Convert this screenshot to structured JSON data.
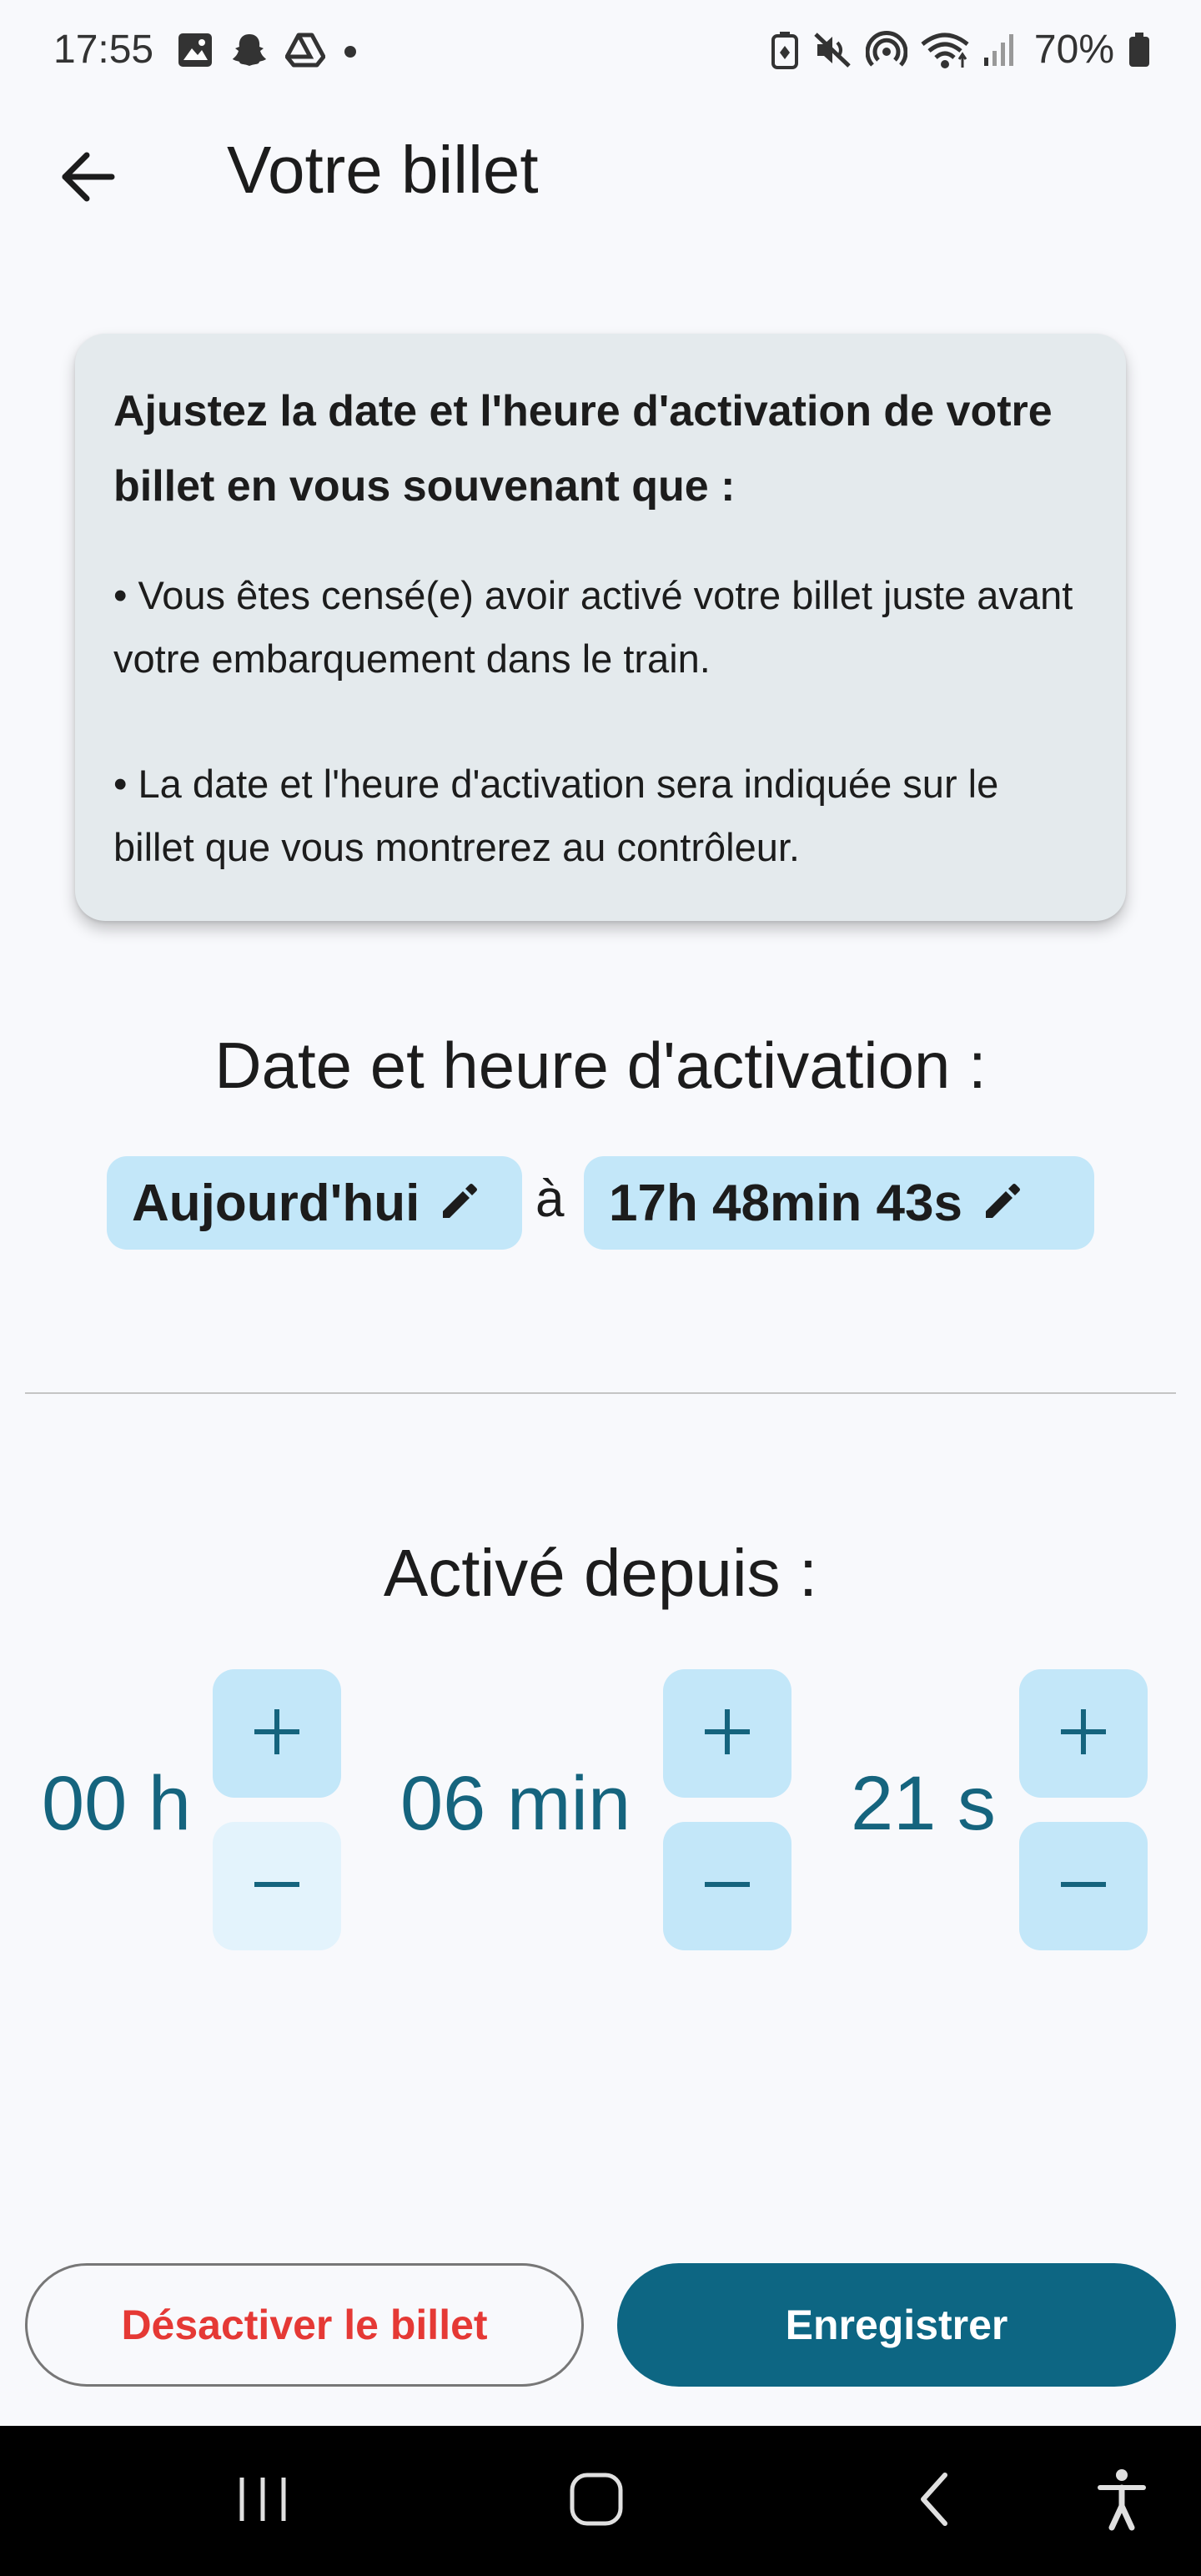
{
  "status_bar": {
    "time": "17:55",
    "battery": "70%",
    "left_icons": [
      "gallery-icon",
      "snapchat-icon",
      "drive-icon",
      "dot-icon"
    ],
    "right_icons": [
      "battery-saver-icon",
      "mute-icon",
      "hotspot-icon",
      "wifi-icon",
      "signal-icon",
      "battery-icon"
    ]
  },
  "app_bar": {
    "title": "Votre billet",
    "back_icon": "arrow-back-icon"
  },
  "info_card": {
    "heading": "Ajustez la date et l'heure d'activation de votre billet en vous souvenant que :",
    "bullets": [
      "• Vous êtes censé(e) avoir activé votre billet juste avant votre embarquement dans le train.",
      "• La date et l'heure d'activation sera indiquée sur le billet que vous montrerez au contrôleur."
    ]
  },
  "activation": {
    "title": "Date et heure d'activation :",
    "date_chip": "Aujourd'hui",
    "connector": "à",
    "time_chip": "17h 48min 43s",
    "edit_icon": "pencil-icon"
  },
  "active_since": {
    "title": "Activé depuis :",
    "hours": "00 h",
    "minutes": "06 min",
    "seconds": "21 s",
    "plus_symbol": "+",
    "minus_symbol": "–"
  },
  "actions": {
    "deactivate_label": "Désactiver le billet",
    "save_label": "Enregistrer"
  },
  "colors": {
    "background": "#F8F9FC",
    "card": "#E4EAED",
    "chip": "#C3E7F9",
    "chip_disabled": "#E3F3FC",
    "accent": "#0D6683",
    "duration_text": "#15647E",
    "danger": "#E53935"
  },
  "nav_bar": {
    "icons": [
      "recents-icon",
      "home-icon",
      "back-nav-icon",
      "accessibility-icon"
    ]
  }
}
